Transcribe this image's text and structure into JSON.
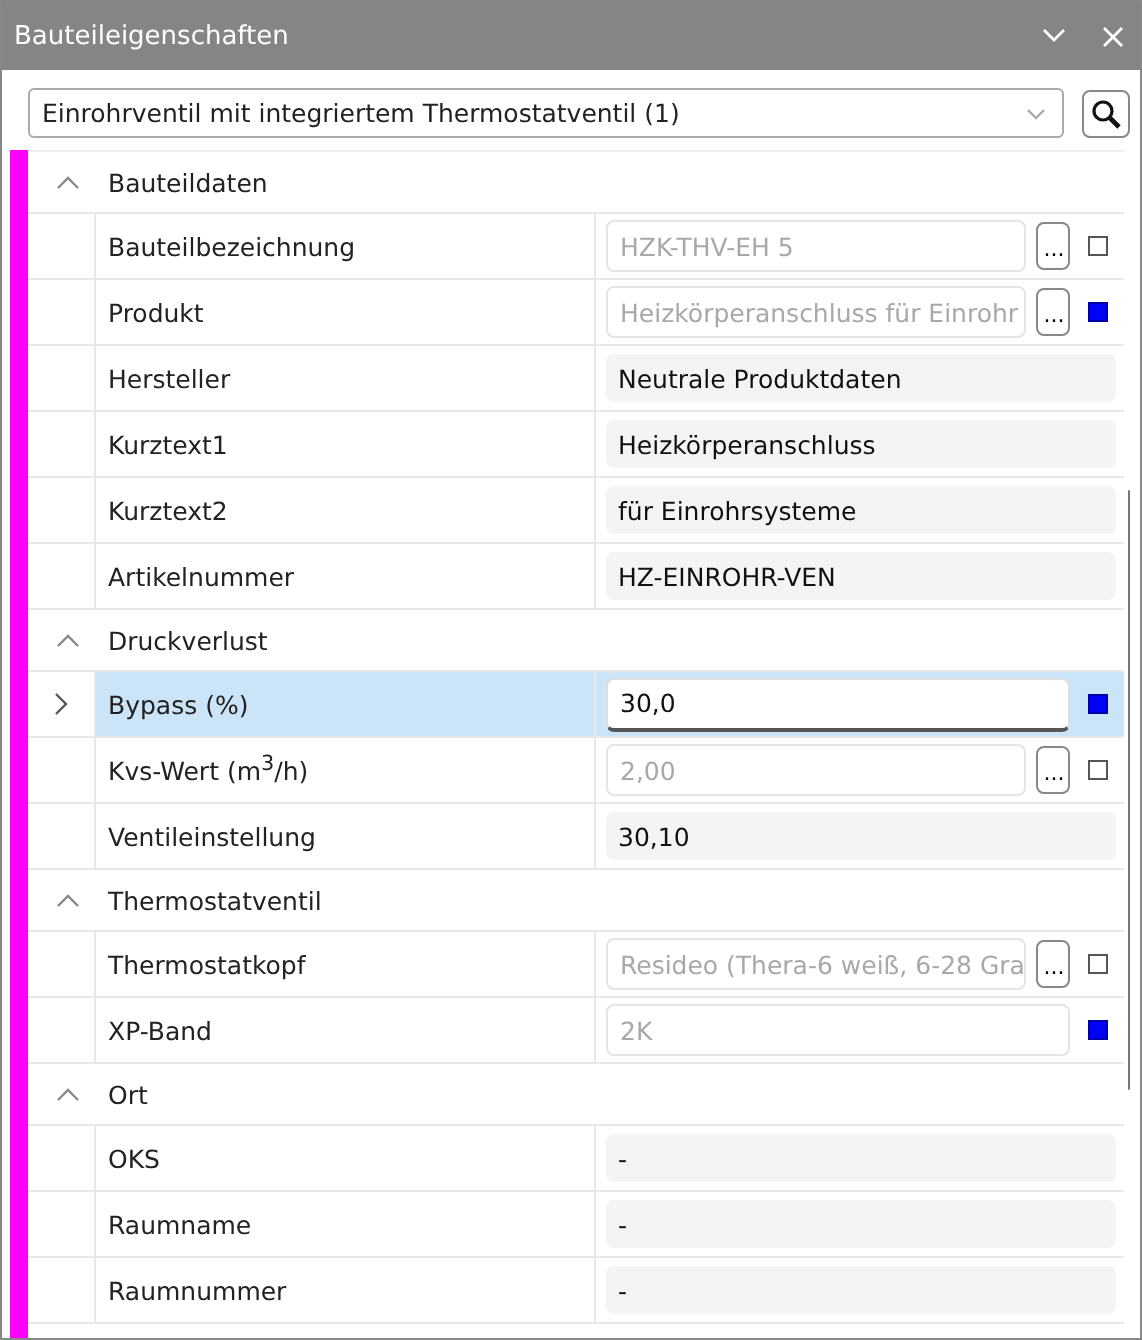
{
  "window": {
    "title": "Bauteileigenschaften"
  },
  "selector": {
    "value": "Einrohrventil mit integriertem Thermostatventil (1)"
  },
  "groups": [
    {
      "title": "Bauteildaten",
      "expanded": true,
      "rows": [
        {
          "label": "Bauteilbezeichnung",
          "value": "HZK-THV-EH 5",
          "kind": "picker",
          "selected": false,
          "marked": false
        },
        {
          "label": "Produkt",
          "value": "Heizkörperanschluss für Einrohr",
          "kind": "picker",
          "selected": false,
          "marked": true
        },
        {
          "label": "Hersteller",
          "value": "Neutrale Produktdaten",
          "kind": "readonly",
          "selected": false
        },
        {
          "label": "Kurztext1",
          "value": "Heizkörperanschluss",
          "kind": "readonly",
          "selected": false
        },
        {
          "label": "Kurztext2",
          "value": "für Einrohrsysteme",
          "kind": "readonly",
          "selected": false
        },
        {
          "label": "Artikelnummer",
          "value": "HZ-EINROHR-VEN",
          "kind": "readonly",
          "selected": false
        }
      ]
    },
    {
      "title": "Druckverlust",
      "expanded": true,
      "rows": [
        {
          "label": "Bypass (%)",
          "value": "30,0",
          "kind": "edit",
          "selected": true,
          "marked": true
        },
        {
          "label": "Kvs-Wert (m$^{3}$/h)",
          "value": "2,00",
          "kind": "picker",
          "selected": false,
          "marked": false
        },
        {
          "label": "Ventileinstellung",
          "value": "30,10",
          "kind": "readonly",
          "selected": false
        }
      ]
    },
    {
      "title": "Thermostatventil",
      "expanded": true,
      "rows": [
        {
          "label": "Thermostatkopf",
          "value": "Resideo (Thera-6 weiß, 6-28 Gra",
          "kind": "picker",
          "selected": false,
          "marked": false
        },
        {
          "label": "XP-Band",
          "value": "2K",
          "kind": "fixed",
          "selected": false,
          "marked": true
        }
      ]
    },
    {
      "title": "Ort",
      "expanded": true,
      "rows": [
        {
          "label": "OKS",
          "value": "-",
          "kind": "readonly",
          "selected": false
        },
        {
          "label": "Raumname",
          "value": "-",
          "kind": "readonly",
          "selected": false
        },
        {
          "label": "Raumnummer",
          "value": "-",
          "kind": "readonly",
          "selected": false
        }
      ]
    }
  ],
  "picker_button": "..."
}
